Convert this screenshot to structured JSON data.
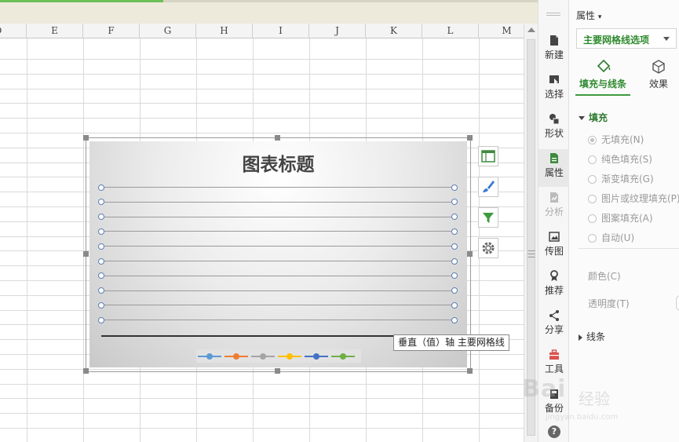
{
  "sheet": {
    "columns": [
      "D",
      "E",
      "F",
      "G",
      "H",
      "I",
      "J",
      "K",
      "L",
      "M"
    ]
  },
  "chart": {
    "title": "图表标题",
    "tooltip": "垂直（值）轴 主要网格线",
    "legend_colors": [
      "#5b9bd5",
      "#ed7d31",
      "#a5a5a5",
      "#ffc000",
      "#4472c4",
      "#70ad47"
    ],
    "tool_buttons": [
      "chart-elements",
      "chart-style",
      "chart-filter",
      "chart-settings"
    ]
  },
  "rail": {
    "items": [
      {
        "label": "新建",
        "icon": "new-doc-icon"
      },
      {
        "label": "选择",
        "icon": "select-cursor-icon"
      },
      {
        "label": "形状",
        "icon": "shapes-icon"
      },
      {
        "label": "属性",
        "icon": "properties-icon"
      },
      {
        "label": "分析",
        "icon": "analysis-icon"
      },
      {
        "label": "传图",
        "icon": "upload-image-icon"
      },
      {
        "label": "推荐",
        "icon": "recommend-icon"
      },
      {
        "label": "分享",
        "icon": "share-icon"
      },
      {
        "label": "工具",
        "icon": "toolbox-icon"
      },
      {
        "label": "备份",
        "icon": "backup-icon"
      }
    ],
    "help": "?"
  },
  "panel": {
    "title": "属性",
    "dropdown": "主要网格线选项",
    "tabs": [
      "填充与线条",
      "效果"
    ],
    "fill_section": "填充",
    "fill_options": [
      {
        "label": "无填充(N)",
        "selected": true
      },
      {
        "label": "纯色填充(S)",
        "selected": false
      },
      {
        "label": "渐变填充(G)",
        "selected": false
      },
      {
        "label": "图片或纹理填充(P)",
        "selected": false
      },
      {
        "label": "图案填充(A)",
        "selected": false
      },
      {
        "label": "自动(U)",
        "selected": false
      }
    ],
    "color_label": "颜色(C)",
    "transparency_label": "透明度(T)",
    "line_section": "线条"
  },
  "watermark": {
    "brand": "Bai",
    "brand_cn": "经验",
    "url": "jingyan.baidu.com"
  }
}
